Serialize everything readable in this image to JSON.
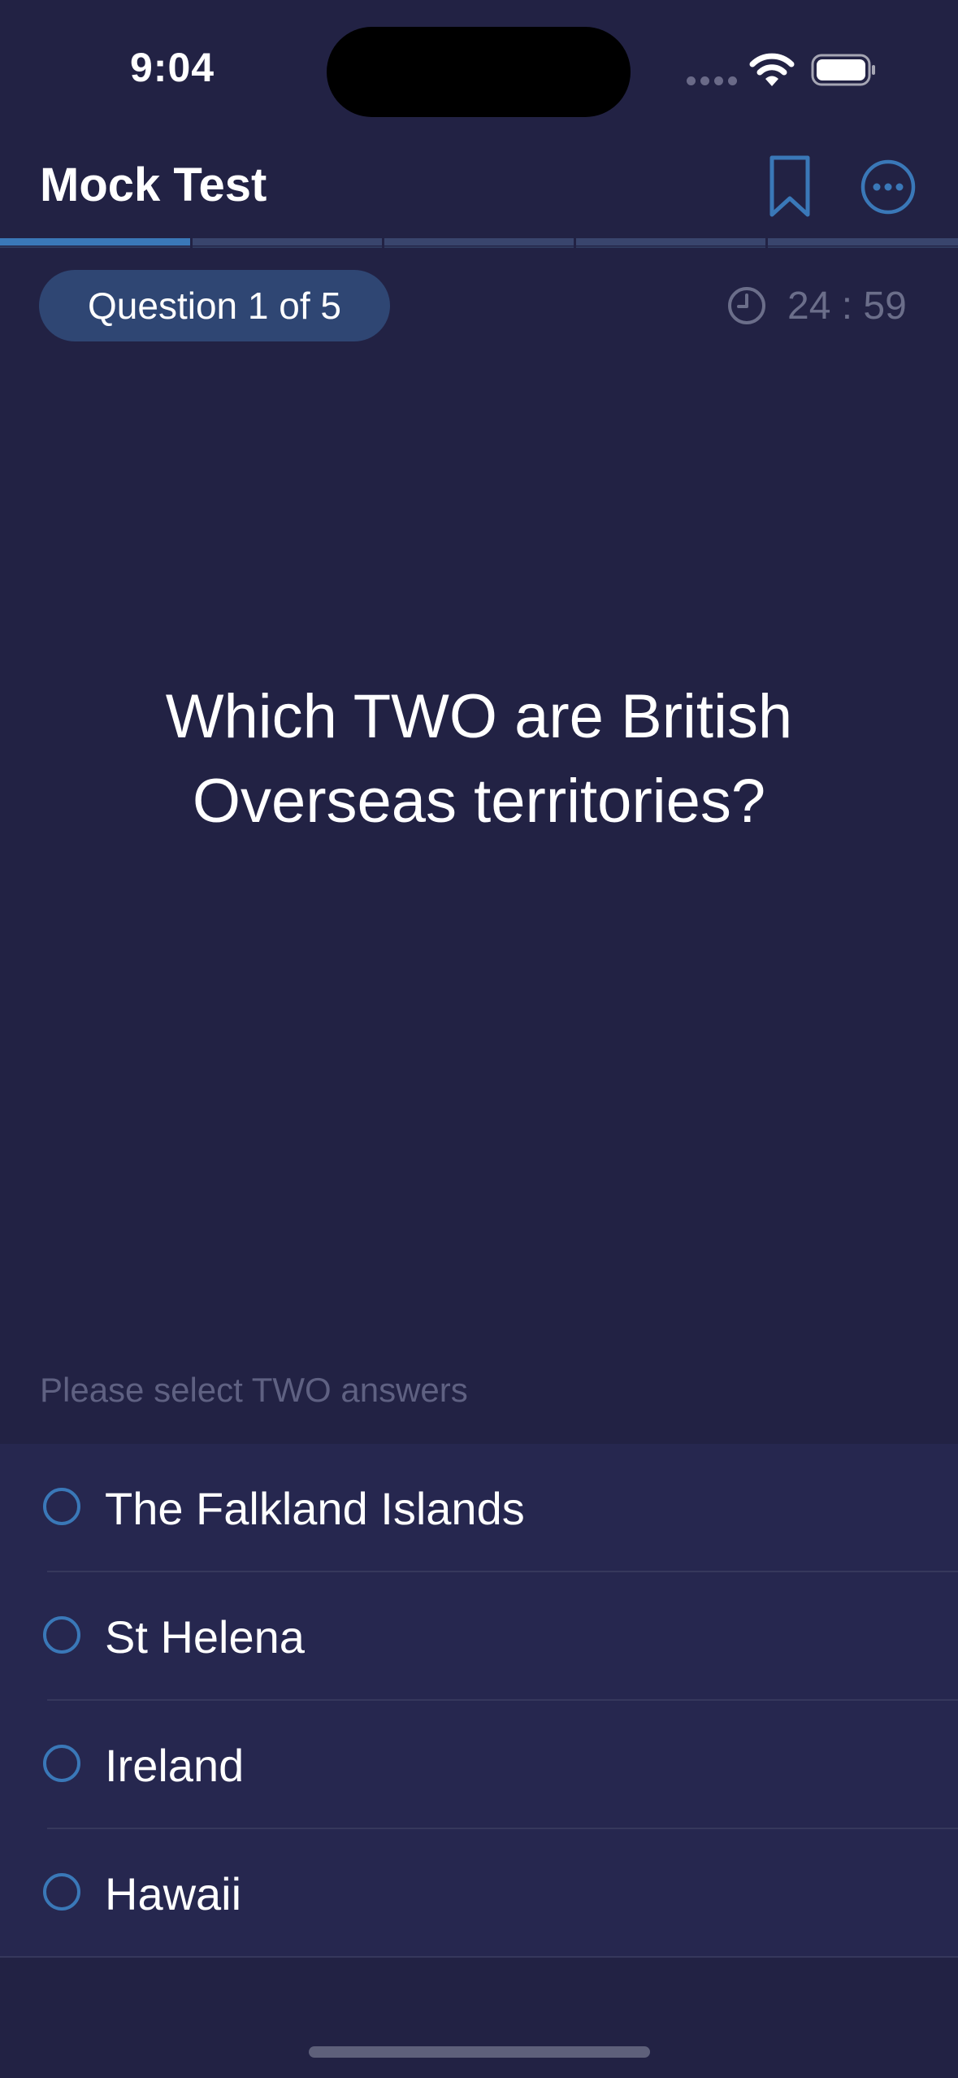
{
  "status_bar": {
    "time": "9:04"
  },
  "nav": {
    "title": "Mock Test"
  },
  "progress": {
    "segments_total": 5,
    "current_index": 1
  },
  "question": {
    "counter": "Question 1 of 5",
    "timer": "24 : 59",
    "text": "Which TWO are British Overseas territories?",
    "hint": "Please select TWO answers"
  },
  "answers": [
    {
      "label": "The Falkland Islands",
      "selected": false
    },
    {
      "label": "St Helena",
      "selected": false
    },
    {
      "label": "Ireland",
      "selected": false
    },
    {
      "label": "Hawaii",
      "selected": false
    }
  ],
  "colors": {
    "background": "#222244",
    "accent": "#3a78b8",
    "answer_background": "#26274f",
    "muted_text": "#6b6e8a"
  }
}
